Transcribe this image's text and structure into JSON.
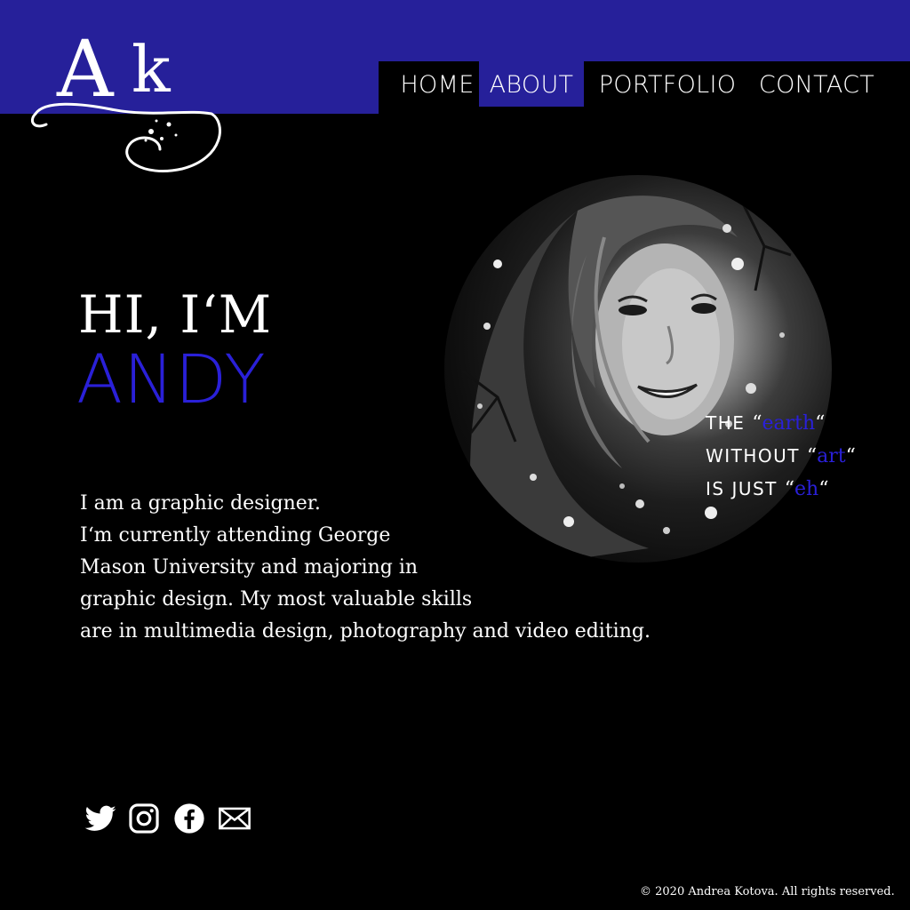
{
  "brand": {
    "logo_text_a": "A",
    "logo_text_k": "k",
    "accent_color": "#26209a",
    "name_color": "#2a20d8"
  },
  "nav": {
    "items": [
      {
        "label": "HOME",
        "active": false
      },
      {
        "label": "ABOUT",
        "active": true
      },
      {
        "label": "PORTFOLIO",
        "active": false
      },
      {
        "label": "CONTACT",
        "active": false
      }
    ]
  },
  "hero": {
    "greeting": "HI, I‘M",
    "name": "ANDY",
    "bio_lines": [
      "I am a graphic designer.",
      "I‘m currently attending George",
      "Mason University and majoring in",
      "graphic design. My most valuable skills",
      "are in multimedia design, photography and video editing."
    ]
  },
  "quote": {
    "line1_prefix": "THE ",
    "line1_word": "earth",
    "line2_prefix": "WITHOUT ",
    "line2_word": "art",
    "line3_prefix": "IS JUST ",
    "line3_word": "eh",
    "open_mark": "“",
    "close_mark": "“"
  },
  "social": {
    "icons": [
      "twitter-icon",
      "instagram-icon",
      "facebook-icon",
      "mail-icon"
    ]
  },
  "footer": {
    "copyright": "© 2020 Andrea Kotova. All rights reserved."
  }
}
